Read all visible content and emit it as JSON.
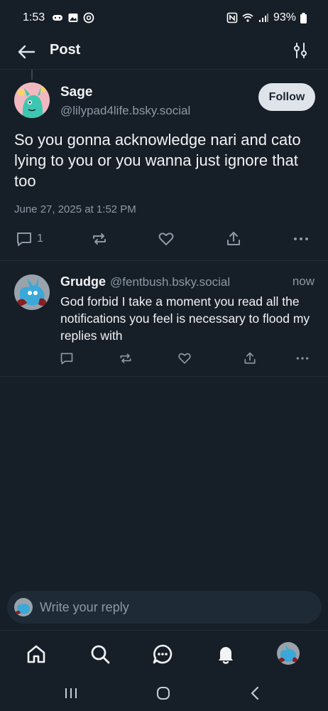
{
  "status_bar": {
    "time": "1:53",
    "battery": "93%"
  },
  "header": {
    "title": "Post"
  },
  "post": {
    "author_name": "Sage",
    "author_handle": "@lilypad4life.bsky.social",
    "follow_label": "Follow",
    "text": "So you gonna acknowledge nari and cato lying to you or you wanna just ignore that too",
    "date": "June 27, 2025 at 1:52 PM",
    "reply_count": "1"
  },
  "reply": {
    "author_name": "Grudge",
    "author_handle": "@fentbush.bsky.social",
    "time": "now",
    "text": "God forbid I take a moment you read all the notifications you feel is necessary to flood my replies with"
  },
  "composer": {
    "placeholder": "Write your reply"
  },
  "icons": {
    "back": "arrow-left-icon",
    "filter": "sliders-icon",
    "reply": "speech-bubble-icon",
    "repost": "repost-icon",
    "like": "heart-icon",
    "share": "share-icon",
    "more": "ellipsis-icon",
    "home": "home-icon",
    "search": "search-icon",
    "chat": "chat-icon",
    "notifications": "bell-icon",
    "profile": "avatar"
  },
  "colors": {
    "background": "#161e27",
    "follow_button": "#dfe4ea",
    "muted_text": "#8d99a6"
  }
}
